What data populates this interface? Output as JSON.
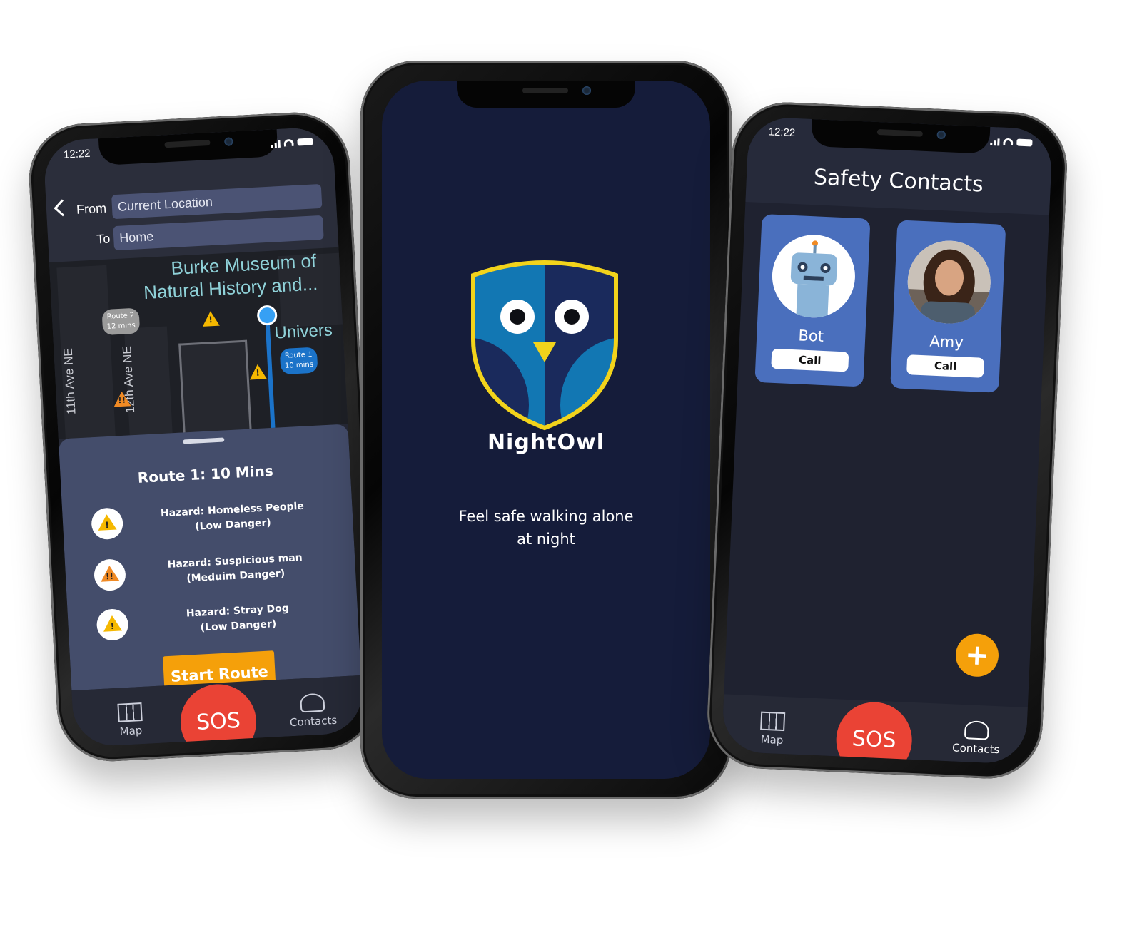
{
  "map_screen": {
    "status_time": "12:22",
    "from_label": "From",
    "from_value": "Current Location",
    "to_label": "To",
    "to_value": "Home",
    "map_labels": {
      "place": "Burke Museum of Natural History and...",
      "place_line1": "Burke Museum of",
      "place_line2": "Natural History and...",
      "univ": "Univers",
      "street1": "12th Ave NE",
      "street2": "11th Ave NE"
    },
    "route2_bubble": {
      "name": "Route 2",
      "time": "12 mins",
      "color": "#9b9b9b"
    },
    "route1_bubble": {
      "name": "Route 1",
      "time": "10 mins",
      "color": "#1b73c9"
    },
    "sheet_title": "Route 1: 10 Mins",
    "hazards": [
      {
        "line1": "Hazard: Homeless People",
        "line2": "(Low Danger)",
        "level": "low",
        "icon": "warning-icon"
      },
      {
        "line1": "Hazard: Suspicious man",
        "line2": "(Meduim Danger)",
        "level": "medium",
        "icon": "double-warning-icon"
      },
      {
        "line1": "Hazard: Stray Dog",
        "line2": "(Low Danger)",
        "level": "low",
        "icon": "warning-icon"
      }
    ],
    "start_button": "Start Route"
  },
  "splash_screen": {
    "app_name": "NightOwl",
    "tagline_line1": "Feel safe walking alone",
    "tagline_line2": "at night"
  },
  "contacts_screen": {
    "status_time": "12:22",
    "title": "Safety Contacts",
    "contacts": [
      {
        "name": "Bot",
        "call_label": "Call",
        "avatar": "robot-avatar"
      },
      {
        "name": "Amy",
        "call_label": "Call",
        "avatar": "photo-avatar"
      }
    ],
    "add_button": "+"
  },
  "tabbar": {
    "map_label": "Map",
    "sos_label": "SOS",
    "contacts_label": "Contacts"
  },
  "colors": {
    "splash_bg": "#151c3a",
    "accent_orange": "#f5a00a",
    "sos_red": "#ea4335",
    "card_blue": "#4a6fbd",
    "logo_yellow": "#f2d31b"
  }
}
